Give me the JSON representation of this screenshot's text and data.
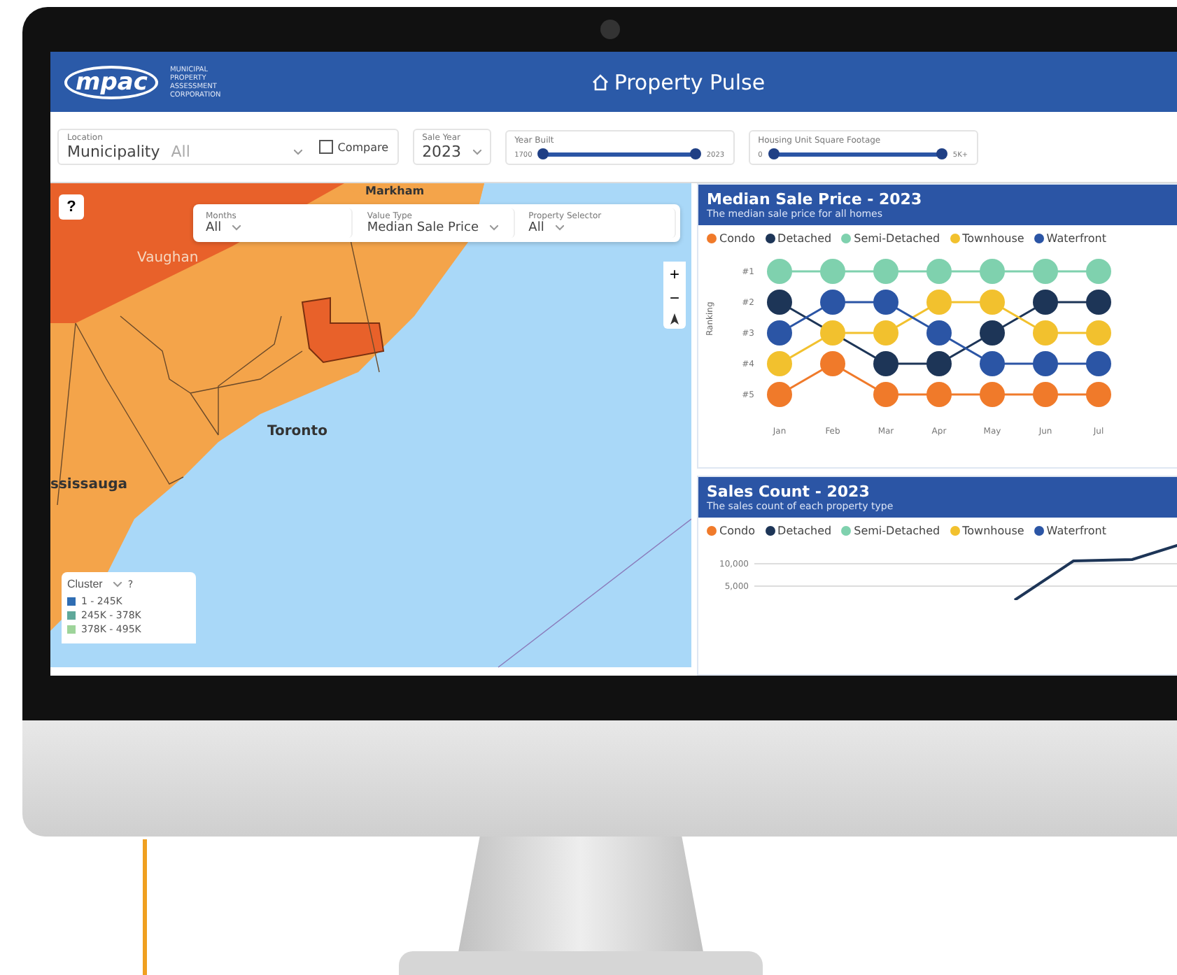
{
  "header": {
    "logo": "mpac",
    "logo_subtitle": [
      "MUNICIPAL",
      "PROPERTY",
      "ASSESSMENT",
      "CORPORATION"
    ],
    "title": "Property Pulse"
  },
  "filters": {
    "location": {
      "label": "Location",
      "value": "Municipality",
      "secondary": "All"
    },
    "compare": {
      "label": "Compare",
      "checked": false
    },
    "sale_year": {
      "label": "Sale Year",
      "value": "2023"
    },
    "sliders": [
      {
        "label": "Year Built",
        "min": "1700",
        "max": "2023",
        "level": 1
      },
      {
        "label": "Housing Unit Square Footage",
        "min": "0",
        "max": "5K+",
        "level": 1
      }
    ]
  },
  "map": {
    "help": "?",
    "filters": [
      {
        "label": "Months",
        "value": "All"
      },
      {
        "label": "Value Type",
        "value": "Median Sale Price"
      },
      {
        "label": "Property Selector",
        "value": "All"
      }
    ],
    "zoom": [
      "+",
      "−"
    ],
    "places": [
      {
        "name": "Markham"
      },
      {
        "name": "Vaughan"
      },
      {
        "name": "Toronto"
      },
      {
        "name": "ssissauga"
      }
    ],
    "legend": {
      "title": "Cluster",
      "help": "?",
      "rows": [
        {
          "range": "1 - 245K",
          "color": "#2f6db3"
        },
        {
          "range": "245K - 378K",
          "color": "#5fa89a"
        },
        {
          "range": "378K - 495K",
          "color": "#9ed49a"
        }
      ]
    }
  },
  "median_price": {
    "title": "Median Sale Price - 2023",
    "subtitle": "The median sale price for all homes",
    "chart_data": {
      "type": "line",
      "ylabel": "Ranking",
      "ylim": [
        5,
        1
      ],
      "categories": [
        "Jan",
        "Feb",
        "Mar",
        "Apr",
        "May",
        "Jun",
        "Jul"
      ],
      "yticks": [
        {
          "value": 1,
          "label": "#1"
        },
        {
          "value": 2,
          "label": "#2"
        },
        {
          "value": 3,
          "label": "#3"
        },
        {
          "value": 4,
          "label": "#4"
        },
        {
          "value": 5,
          "label": "#5"
        }
      ],
      "series": [
        {
          "name": "Condo",
          "color": "#f07a2a",
          "marker": "circle",
          "values": [
            5,
            4,
            5,
            5,
            5,
            5,
            5
          ]
        },
        {
          "name": "Detached",
          "color": "#1d3557",
          "marker": "circle",
          "values": [
            2,
            null,
            4,
            4,
            3,
            2,
            2
          ]
        },
        {
          "name": "Semi-Detached",
          "color": "#7fd1ae",
          "marker": "circle",
          "values": [
            1,
            1,
            1,
            1,
            1,
            1,
            1
          ]
        },
        {
          "name": "Townhouse",
          "color": "#f2c12e",
          "marker": "circle",
          "values": [
            4,
            3,
            3,
            2,
            2,
            3,
            3
          ]
        },
        {
          "name": "Waterfront",
          "color": "#2b55a5",
          "marker": "circle",
          "values": [
            3,
            2,
            2,
            3,
            4,
            4,
            4
          ]
        }
      ]
    }
  },
  "sales_count": {
    "title": "Sales Count - 2023",
    "subtitle": "The sales count of each property type",
    "legend": [
      {
        "name": "Condo",
        "color": "#f07a2a"
      },
      {
        "name": "Detached",
        "color": "#1d3557"
      },
      {
        "name": "Semi-Detached",
        "color": "#7fd1ae"
      },
      {
        "name": "Townhouse",
        "color": "#f2c12e"
      },
      {
        "name": "Waterfront",
        "color": "#2b55a5"
      }
    ],
    "y_axis_labels": [
      "10,000",
      "5,000"
    ]
  }
}
